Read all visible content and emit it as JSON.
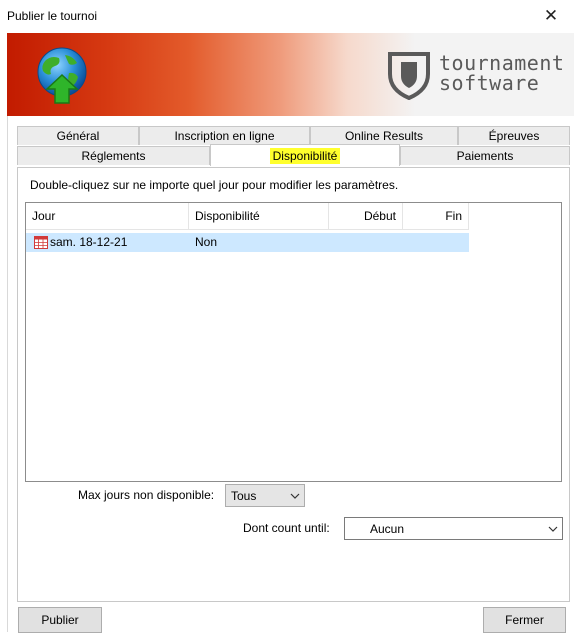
{
  "window": {
    "title": "Publier le tournoi"
  },
  "banner": {
    "logo_line1": "tournament",
    "logo_line2": "software"
  },
  "tabs": {
    "row1": [
      "Général",
      "Inscription en ligne",
      "Online Results",
      "Épreuves"
    ],
    "row2": [
      "Réglements",
      "Disponibilité",
      "Paiements"
    ],
    "active": "Disponibilité"
  },
  "instructions": "Double-cliquez sur ne importe quel jour pour modifier les paramètres.",
  "table": {
    "columns": [
      "Jour",
      "Disponibilité",
      "Début",
      "Fin"
    ],
    "rows": [
      {
        "jour": "sam. 18-12-21",
        "disponibilite": "Non",
        "debut": "",
        "fin": ""
      }
    ]
  },
  "max_jours": {
    "label": "Max jours non disponible:",
    "value": "Tous"
  },
  "dont_count": {
    "label": "Dont count until:",
    "value": "Aucun"
  },
  "buttons": {
    "publier": "Publier",
    "fermer": "Fermer"
  },
  "colors": {
    "highlight": "#ffff2d",
    "selection": "#cde8ff",
    "banner_red": "#c21b00"
  }
}
